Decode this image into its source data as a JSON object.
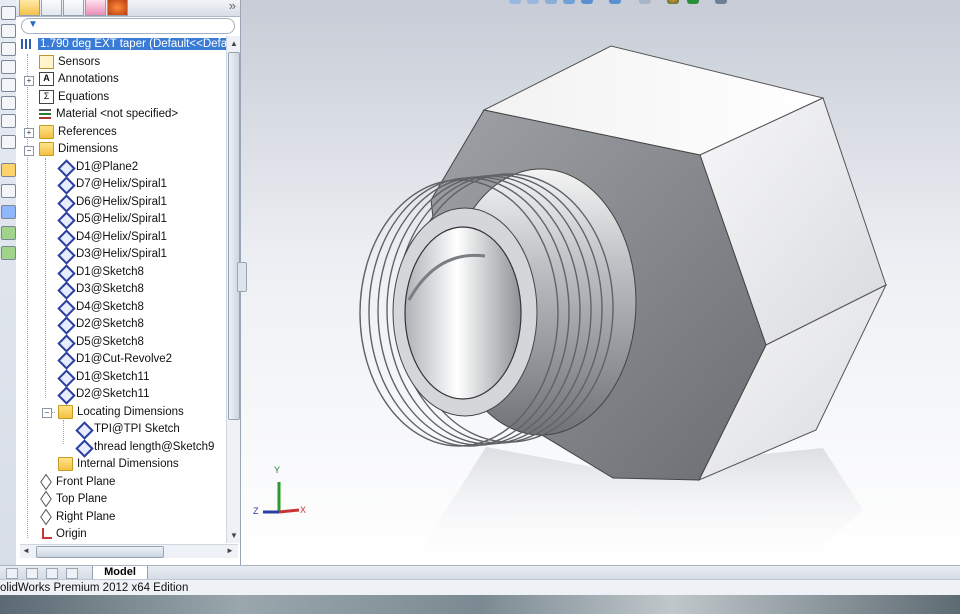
{
  "panel": {
    "tree": [
      {
        "label": "1.790 deg EXT taper  (Default<<Defa",
        "icon": "part-icon",
        "selected": true
      },
      {
        "label": "Sensors",
        "icon": "sensor-icon"
      },
      {
        "label": "Annotations",
        "icon": "annotations-icon",
        "expander": "+"
      },
      {
        "label": "Equations",
        "icon": "equations-icon"
      },
      {
        "label": "Material <not specified>",
        "icon": "material-icon"
      },
      {
        "label": "References",
        "icon": "folder-icon",
        "expander": "+"
      },
      {
        "label": "Dimensions",
        "icon": "folder-icon",
        "expander": "-"
      },
      {
        "label": "D1@Plane2",
        "icon": "dimension-icon"
      },
      {
        "label": "D7@Helix/Spiral1",
        "icon": "dimension-icon"
      },
      {
        "label": "D6@Helix/Spiral1",
        "icon": "dimension-icon"
      },
      {
        "label": "D5@Helix/Spiral1",
        "icon": "dimension-icon"
      },
      {
        "label": "D4@Helix/Spiral1",
        "icon": "dimension-icon"
      },
      {
        "label": "D3@Helix/Spiral1",
        "icon": "dimension-icon"
      },
      {
        "label": "D1@Sketch8",
        "icon": "dimension-icon"
      },
      {
        "label": "D3@Sketch8",
        "icon": "dimension-icon"
      },
      {
        "label": "D4@Sketch8",
        "icon": "dimension-icon"
      },
      {
        "label": "D2@Sketch8",
        "icon": "dimension-icon"
      },
      {
        "label": "D5@Sketch8",
        "icon": "dimension-icon"
      },
      {
        "label": "D1@Cut-Revolve2",
        "icon": "dimension-icon"
      },
      {
        "label": "D1@Sketch11",
        "icon": "dimension-icon"
      },
      {
        "label": "D2@Sketch11",
        "icon": "dimension-icon"
      },
      {
        "label": "Locating Dimensions",
        "icon": "folder-icon",
        "expander": "-"
      },
      {
        "label": "TPI@TPI Sketch",
        "icon": "dimension-icon"
      },
      {
        "label": "thread length@Sketch9",
        "icon": "dimension-icon"
      },
      {
        "label": "Internal Dimensions",
        "icon": "folder-icon"
      },
      {
        "label": "Front Plane",
        "icon": "plane-icon"
      },
      {
        "label": "Top Plane",
        "icon": "plane-icon"
      },
      {
        "label": "Right Plane",
        "icon": "plane-icon"
      },
      {
        "label": "Origin",
        "icon": "origin-icon"
      }
    ]
  },
  "bottom": {
    "model_tab": "Model",
    "status": "olidWorks Premium 2012 x64 Edition"
  },
  "triad": {
    "x": "X",
    "y": "Y",
    "z": "Z"
  },
  "colors": {
    "selection": "#3a7bd5",
    "folder": "#f2c143",
    "dimension": "#2b3f9e"
  }
}
